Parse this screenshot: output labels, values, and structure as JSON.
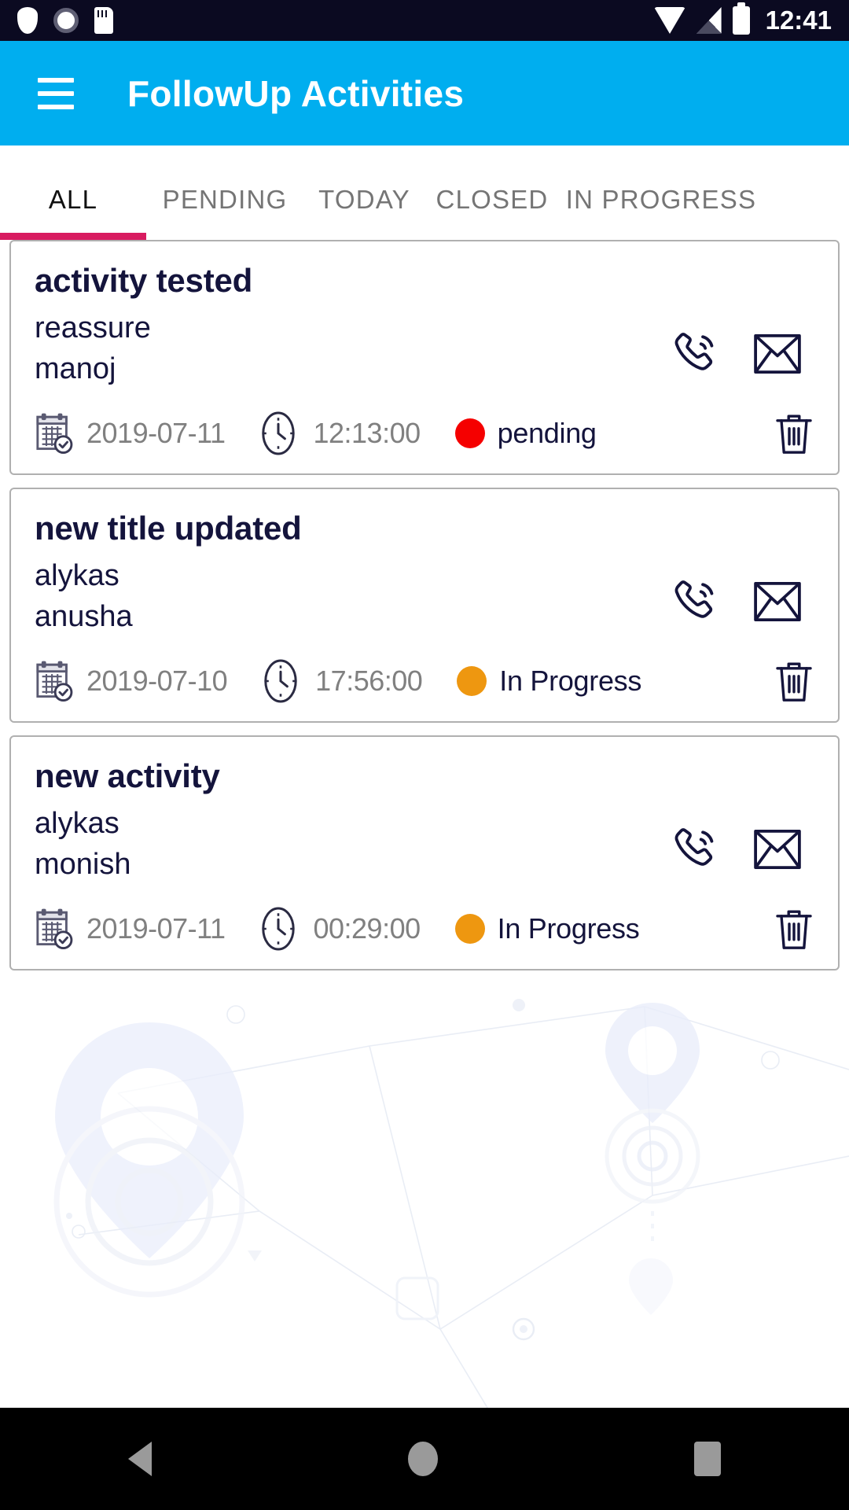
{
  "statusbar": {
    "time": "12:41",
    "icons": [
      "shield-icon",
      "dial-icon",
      "sd-card-icon",
      "wifi-icon",
      "signal-icon",
      "battery-icon"
    ]
  },
  "appbar": {
    "menu_icon": "hamburger-menu-icon",
    "title": "FollowUp Activities",
    "background": "#00AEEF"
  },
  "decoration": {
    "dot_grid_colors": [
      "#b9a8ea",
      "#b5aeea",
      "#b0b4ea",
      "#a9bcea",
      "#9fc6ea",
      "#94cfe8",
      "#86d8e0",
      "#79e0d5",
      "#6ce5c9",
      "#5eeaba",
      "#52edae",
      "#47efa2",
      "#3df199",
      "#35f292"
    ]
  },
  "tabs": {
    "active_index": 0,
    "indicator_color": "#D81B60",
    "items": [
      {
        "label": "ALL"
      },
      {
        "label": "PENDING"
      },
      {
        "label": "TODAY"
      },
      {
        "label": "CLOSED"
      },
      {
        "label": "IN PROGRESS"
      }
    ]
  },
  "cards": [
    {
      "title": "activity tested",
      "line2": "reassure",
      "line3": "manoj",
      "date": "2019-07-11",
      "time": "12:13:00",
      "status": "pending",
      "status_color": "#F50000",
      "call_icon": "phone-call-icon",
      "mail_icon": "envelope-icon",
      "delete_icon": "trash-icon",
      "date_icon": "calendar-check-icon",
      "time_icon": "clock-icon"
    },
    {
      "title": "new title updated",
      "line2": "alykas",
      "line3": "anusha",
      "date": "2019-07-10",
      "time": "17:56:00",
      "status": "In Progress",
      "status_color": "#EE9710",
      "call_icon": "phone-call-icon",
      "mail_icon": "envelope-icon",
      "delete_icon": "trash-icon",
      "date_icon": "calendar-check-icon",
      "time_icon": "clock-icon"
    },
    {
      "title": "new activity",
      "line2": "alykas",
      "line3": "monish",
      "date": "2019-07-11",
      "time": "00:29:00",
      "status": "In Progress",
      "status_color": "#EE9710",
      "call_icon": "phone-call-icon",
      "mail_icon": "envelope-icon",
      "delete_icon": "trash-icon",
      "date_icon": "calendar-check-icon",
      "time_icon": "clock-icon"
    }
  ],
  "navbar": {
    "back": "back-triangle-icon",
    "home": "home-circle-icon",
    "recents": "recents-square-icon"
  }
}
